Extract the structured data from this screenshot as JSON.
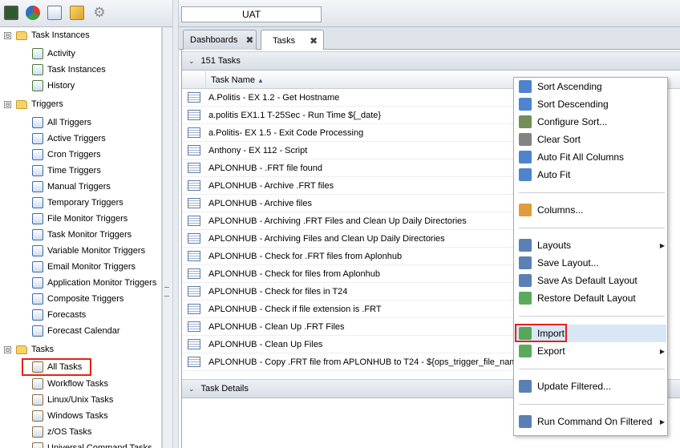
{
  "left_toolbar": {
    "icons": [
      "dashboard-icon",
      "pie-chart-icon",
      "report-icon",
      "bundle-icon",
      "gear-icon"
    ]
  },
  "tree": {
    "groups": [
      {
        "label": "Task Instances",
        "items": [
          "Activity",
          "Task Instances",
          "History"
        ]
      },
      {
        "label": "Triggers",
        "items": [
          "All Triggers",
          "Active Triggers",
          "Cron Triggers",
          "Time Triggers",
          "Manual Triggers",
          "Temporary Triggers",
          "File Monitor Triggers",
          "Task Monitor Triggers",
          "Variable Monitor Triggers",
          "Email Monitor Triggers",
          "Application Monitor Triggers",
          "Composite Triggers",
          "Forecasts",
          "Forecast Calendar"
        ]
      },
      {
        "label": "Tasks",
        "items": [
          "All Tasks",
          "Workflow Tasks",
          "Linux/Unix Tasks",
          "Windows Tasks",
          "z/OS Tasks",
          "Universal Command Tasks"
        ]
      }
    ],
    "toggle_symbol": "⊟"
  },
  "environment_label": "UAT",
  "tabs": [
    {
      "label": "Dashboards",
      "close": "✖"
    },
    {
      "label": "Tasks",
      "close": "✖"
    }
  ],
  "list_header": {
    "caret": "⌄",
    "count_label": "151 Tasks"
  },
  "column": {
    "title": "Task Name",
    "sort": "▲"
  },
  "rows": [
    "A.Politis - EX 1.2 - Get Hostname",
    "a.politis EX1.1  T-25Sec - Run Time ${_date}",
    "a.Politis- EX 1.5 - Exit Code Processing",
    "Anthony - EX 112 - Script",
    "APLONHUB - .FRT file found",
    "APLONHUB - Archive .FRT files",
    "APLONHUB - Archive files",
    "APLONHUB - Archiving .FRT Files and Clean Up Daily Directories",
    "APLONHUB - Archiving Files and Clean Up Daily Directories",
    "APLONHUB - Check for .FRT files from Aplonhub",
    "APLONHUB - Check for files from Aplonhub",
    "APLONHUB - Check for files in T24",
    "APLONHUB - Check if file extension is .FRT",
    "APLONHUB - Clean Up .FRT Files",
    "APLONHUB - Clean Up Files",
    "APLONHUB - Copy .FRT file from APLONHUB to T24 - ${ops_trigger_file_nam"
  ],
  "details_header": {
    "caret": "⌄",
    "label": "Task Details"
  },
  "context_menu": {
    "items": [
      {
        "label": "Sort Ascending",
        "icon": "sort-ascending-icon",
        "color": "#2f6fc4"
      },
      {
        "label": "Sort Descending",
        "icon": "sort-descending-icon",
        "color": "#2f6fc4"
      },
      {
        "label": "Configure Sort...",
        "icon": "configure-sort-icon",
        "color": "#5b7a3a"
      },
      {
        "label": "Clear Sort",
        "icon": "clear-sort-icon",
        "color": "#6d6d6d"
      },
      {
        "label": "Auto Fit All Columns",
        "icon": "auto-fit-all-icon",
        "color": "#2f6fc4"
      },
      {
        "label": "Auto Fit",
        "icon": "auto-fit-icon",
        "color": "#2f6fc4"
      },
      {
        "label": "Columns...",
        "icon": "columns-icon",
        "color": "#d98a1c"
      },
      {
        "label": "Layouts",
        "icon": "layouts-icon",
        "color": "#3d6aa8",
        "submenu": "▶"
      },
      {
        "label": "Save Layout...",
        "icon": "save-layout-icon",
        "color": "#3d6aa8"
      },
      {
        "label": "Save As Default Layout",
        "icon": "save-default-layout-icon",
        "color": "#3d6aa8"
      },
      {
        "label": "Restore Default Layout",
        "icon": "restore-default-layout-icon",
        "color": "#3e9b3e"
      },
      {
        "label": "Import",
        "icon": "import-icon",
        "color": "#3e9b3e"
      },
      {
        "label": "Export",
        "icon": "export-icon",
        "color": "#3e9b3e",
        "submenu": "▶"
      },
      {
        "label": "Update Filtered...",
        "icon": "update-filtered-icon",
        "color": "#3d6aa8"
      },
      {
        "label": "Run Command On Filtered",
        "icon": "run-command-icon",
        "color": "#3d6aa8",
        "submenu": "▶"
      }
    ]
  }
}
